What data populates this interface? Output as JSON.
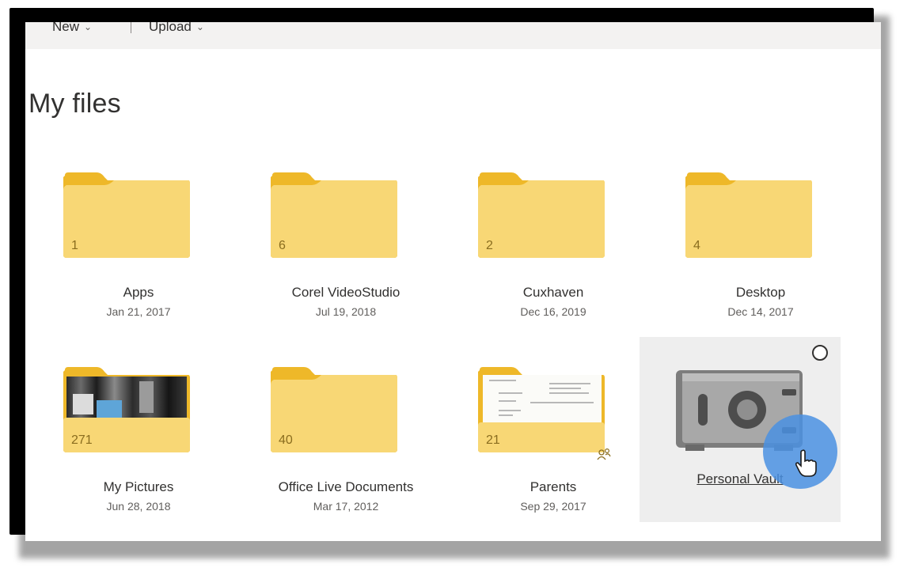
{
  "commandbar": {
    "new_label": "New",
    "upload_label": "Upload"
  },
  "page": {
    "title": "My files"
  },
  "folders": [
    {
      "name": "Apps",
      "date": "Jan 21, 2017",
      "count": "1"
    },
    {
      "name": "Corel VideoStudio",
      "date": "Jul 19, 2018",
      "count": "6"
    },
    {
      "name": "Cuxhaven",
      "date": "Dec 16, 2019",
      "count": "2"
    },
    {
      "name": "Desktop",
      "date": "Dec 14, 2017",
      "count": "4"
    },
    {
      "name": "My Pictures",
      "date": "Jun 28, 2018",
      "count": "271"
    },
    {
      "name": "Office Live Documents",
      "date": "Mar 17, 2012",
      "count": "40"
    },
    {
      "name": "Parents",
      "date": "Sep 29, 2017",
      "count": "21"
    }
  ],
  "vault": {
    "name": "Personal Vault",
    "icon": "safe-icon"
  },
  "colors": {
    "folder": "#f8d775",
    "folder_tab": "#eeb829",
    "vault_bg": "#eeeeee",
    "cursor_highlight": "#4a90e2"
  }
}
